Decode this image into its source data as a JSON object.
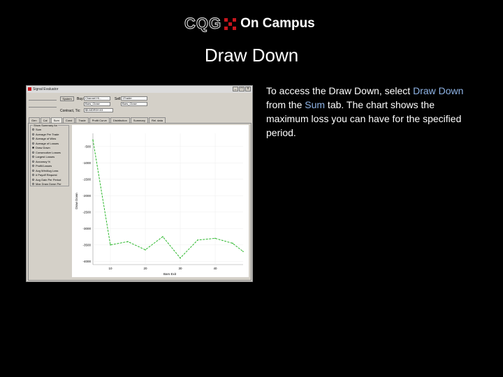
{
  "logo": {
    "brand": "CQG",
    "text": "On Campus"
  },
  "slide": {
    "title": "Draw Down"
  },
  "description": {
    "part1": "To access the Draw Down, select ",
    "link1": "Draw Down",
    "part2": " from the ",
    "link2": "Sum",
    "part3": " tab. The chart shows the maximum loss you can have for the specified period."
  },
  "colors": {
    "highlight": "#8fb4e6",
    "line": "#2db82d",
    "logo_red": "#c8161d"
  },
  "window": {
    "title": "Signal Evaluator",
    "controls": {
      "minimize": "_",
      "maximize": "□",
      "close": "x"
    },
    "fields": {
      "system_button": "System",
      "buy_label": "Buy:",
      "buy_value": "Channel Hi...",
      "buy_price": "Bars_Close",
      "sell_label": "Sell:",
      "sell_value": "1Trader",
      "sell_price": "Bars_Close",
      "contract_label": "Contract, Tic:",
      "contract_value": "$5.MDR0H:03"
    },
    "tabs": [
      "Gen",
      "Cal",
      "Sum",
      "Cond",
      "Trade",
      "Profit Curve",
      "Distribution",
      "Summary",
      "Rel. data"
    ],
    "active_tab": "Sum",
    "group_label": "Show Summary for",
    "options": [
      {
        "label": "Sum",
        "selected": false
      },
      {
        "label": "Average Per Trade",
        "selected": false
      },
      {
        "label": "Average of Wins",
        "selected": false
      },
      {
        "label": "Average of Losses",
        "selected": false
      },
      {
        "label": "Draw Down",
        "selected": true
      },
      {
        "label": "Consecutive Losses",
        "selected": false
      },
      {
        "label": "Largest Losses",
        "selected": false
      },
      {
        "label": "Accuracy %",
        "selected": false
      },
      {
        "label": "Profit/Losses",
        "selected": false
      },
      {
        "label": "Avg Win/Avg Loss",
        "selected": false
      },
      {
        "label": "# Payoff Request",
        "selected": false
      },
      {
        "label": "Avg Gain Per Period",
        "selected": false
      },
      {
        "label": "Max Draw Down Per",
        "selected": false
      }
    ]
  },
  "chart_data": {
    "type": "line",
    "xlabel": "Bars Exit",
    "ylabel": "Draw Down",
    "x_ticks": [
      "10",
      "20",
      "30",
      "40"
    ],
    "y_ticks": [
      "-500",
      "-1000",
      "-1500",
      "-2000",
      "-2500",
      "-3000",
      "-3500",
      "-4000"
    ],
    "xlim": [
      5,
      48
    ],
    "ylim": [
      -4100,
      -100
    ],
    "grid": true,
    "series": [
      {
        "x": [
          5,
          10,
          15,
          20,
          25,
          30,
          35,
          40,
          45,
          48
        ],
        "y": [
          -300,
          -3500,
          -3400,
          -3650,
          -3250,
          -3900,
          -3350,
          -3300,
          -3450,
          -3700
        ]
      }
    ]
  }
}
